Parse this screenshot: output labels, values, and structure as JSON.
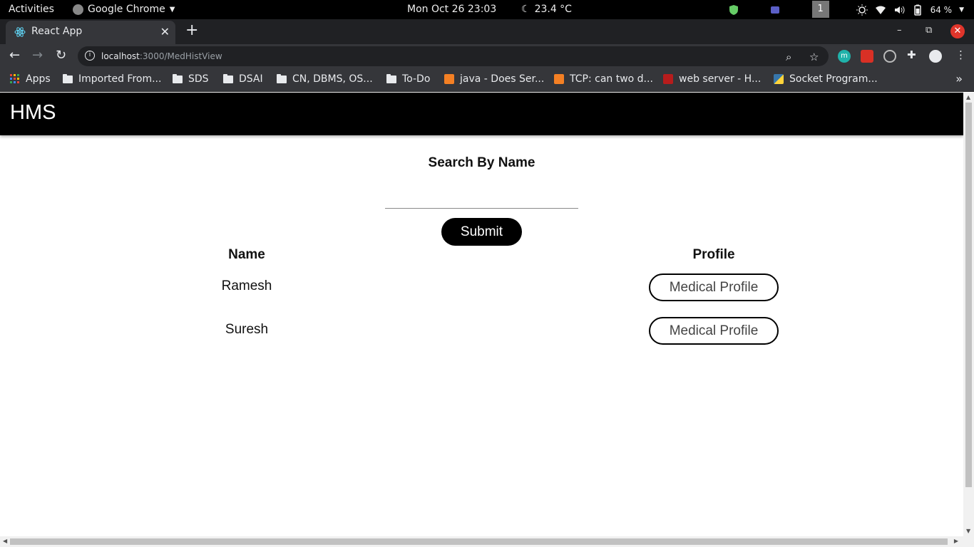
{
  "system_bar": {
    "activities": "Activities",
    "app_name": "Google Chrome",
    "clock": "Mon Oct 26  23:03",
    "weather": "23.4 °C",
    "workspace": "1",
    "battery": "64 %"
  },
  "browser": {
    "tab_title": "React App",
    "url_host": "localhost",
    "url_path": ":3000/MedHistView",
    "extension_m": "m",
    "bookmarks": [
      {
        "label": "Apps",
        "icon": "apps-grid-icon"
      },
      {
        "label": "Imported From...",
        "icon": "folder-icon"
      },
      {
        "label": "SDS",
        "icon": "folder-icon"
      },
      {
        "label": "DSAI",
        "icon": "folder-icon"
      },
      {
        "label": "CN, DBMS, OS...",
        "icon": "folder-icon"
      },
      {
        "label": "To-Do",
        "icon": "folder-icon"
      },
      {
        "label": "java - Does Ser...",
        "icon": "stackoverflow-icon"
      },
      {
        "label": "TCP: can two d...",
        "icon": "stackoverflow-icon"
      },
      {
        "label": "web server - H...",
        "icon": "serverfault-icon"
      },
      {
        "label": "Socket Program...",
        "icon": "python-icon"
      }
    ]
  },
  "page": {
    "brand": "HMS",
    "search_title": "Search By Name",
    "search_value": "",
    "submit_label": "Submit",
    "table": {
      "headers": [
        "Name",
        "Profile"
      ],
      "rows": [
        {
          "name": "Ramesh",
          "action": "Medical Profile"
        },
        {
          "name": "Suresh",
          "action": "Medical Profile"
        }
      ]
    }
  },
  "colors": {
    "navbar_bg": "#000000",
    "submit_bg": "#000000",
    "chrome_dark": "#35363a"
  }
}
